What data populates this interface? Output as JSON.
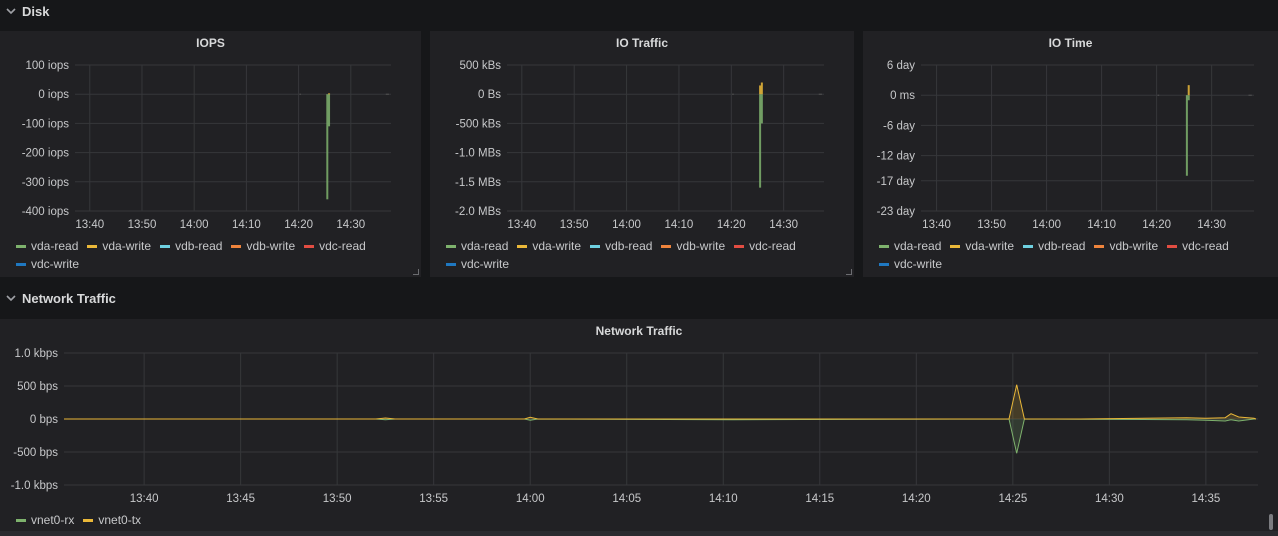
{
  "rows": {
    "disk": {
      "title": "Disk"
    },
    "network": {
      "title": "Network Traffic"
    }
  },
  "panels": {
    "iops": {
      "title": "IOPS",
      "yticks": [
        "100 iops",
        "0 iops",
        "-100 iops",
        "-200 iops",
        "-300 iops",
        "-400 iops"
      ],
      "xticks": [
        "13:40",
        "13:50",
        "14:00",
        "14:10",
        "14:20",
        "14:30"
      ],
      "legend": [
        "vda-read",
        "vda-write",
        "vdb-read",
        "vdb-write",
        "vdc-read",
        "vdc-write"
      ]
    },
    "io_traffic": {
      "title": "IO Traffic",
      "yticks": [
        "500 kBs",
        "0 Bs",
        "-500 kBs",
        "-1.0 MBs",
        "-1.5 MBs",
        "-2.0 MBs"
      ],
      "xticks": [
        "13:40",
        "13:50",
        "14:00",
        "14:10",
        "14:20",
        "14:30"
      ],
      "legend": [
        "vda-read",
        "vda-write",
        "vdb-read",
        "vdb-write",
        "vdc-read",
        "vdc-write"
      ]
    },
    "io_time": {
      "title": "IO Time",
      "yticks": [
        "6 day",
        "0 ms",
        "-6 day",
        "-12 day",
        "-17 day",
        "-23 day"
      ],
      "xticks": [
        "13:40",
        "13:50",
        "14:00",
        "14:10",
        "14:20",
        "14:30"
      ],
      "legend": [
        "vda-read",
        "vda-write",
        "vdb-read",
        "vdb-write",
        "vdc-read",
        "vdc-write"
      ]
    },
    "network": {
      "title": "Network Traffic",
      "yticks": [
        "1.0 kbps",
        "500 bps",
        "0 bps",
        "-500 bps",
        "-1.0 kbps"
      ],
      "xticks": [
        "13:40",
        "13:45",
        "13:50",
        "13:55",
        "14:00",
        "14:05",
        "14:10",
        "14:15",
        "14:20",
        "14:25",
        "14:30",
        "14:35"
      ],
      "legend": [
        "vnet0-rx",
        "vnet0-tx"
      ]
    }
  },
  "colors": {
    "vda-read": "#7eb26d",
    "vda-write": "#eab839",
    "vdb-read": "#6ed0e0",
    "vdb-write": "#ef843c",
    "vdc-read": "#e24d42",
    "vdc-write": "#1f78c1",
    "vnet0-rx": "#7eb26d",
    "vnet0-tx": "#eab839"
  },
  "icons": {
    "collapse": "chevron-down-icon"
  },
  "chart_data": [
    {
      "type": "bar",
      "title": "IOPS",
      "x": [
        "14:25:30",
        "14:25:50",
        "14:26:10"
      ],
      "series": [
        {
          "name": "vda-read",
          "values": [
            -360,
            -110,
            0
          ]
        },
        {
          "name": "vda-write",
          "values": [
            0,
            3,
            0
          ]
        }
      ],
      "ylim": [
        -400,
        100
      ]
    },
    {
      "type": "bar",
      "title": "IO Traffic",
      "x": [
        "14:25:30",
        "14:25:50",
        "14:26:10"
      ],
      "series": [
        {
          "name": "vda-read",
          "values": [
            -1600,
            -500,
            0
          ]
        },
        {
          "name": "vda-write",
          "values": [
            150,
            200,
            0
          ]
        }
      ],
      "ylim": [
        -2000,
        500
      ]
    },
    {
      "type": "bar",
      "title": "IO Time",
      "x": [
        "14:25:30",
        "14:25:50"
      ],
      "series": [
        {
          "name": "vda-read",
          "values": [
            -16,
            -1
          ]
        },
        {
          "name": "vda-write",
          "values": [
            0,
            2
          ]
        }
      ],
      "ylim": [
        -23,
        6
      ]
    },
    {
      "type": "area",
      "title": "Network Traffic",
      "x": [
        "13:37",
        "13:52",
        "13:52.5",
        "13:53",
        "13:59.7",
        "14:00",
        "14:00.4",
        "14:10.5",
        "14:24.8",
        "14:25.2",
        "14:25.6",
        "14:28.5",
        "14:34",
        "14:35",
        "14:36",
        "14:36.3",
        "14:36.7",
        "14:37.5"
      ],
      "series": [
        {
          "name": "vnet0-rx",
          "values": [
            0,
            0,
            -10,
            0,
            0,
            -20,
            0,
            -10,
            0,
            -520,
            0,
            -5,
            -10,
            -20,
            -30,
            -10,
            -30,
            0
          ]
        },
        {
          "name": "vnet0-tx",
          "values": [
            0,
            0,
            15,
            0,
            0,
            25,
            0,
            0,
            0,
            520,
            0,
            0,
            20,
            10,
            20,
            80,
            30,
            10
          ]
        }
      ],
      "ylim": [
        -1000,
        1000
      ]
    }
  ]
}
